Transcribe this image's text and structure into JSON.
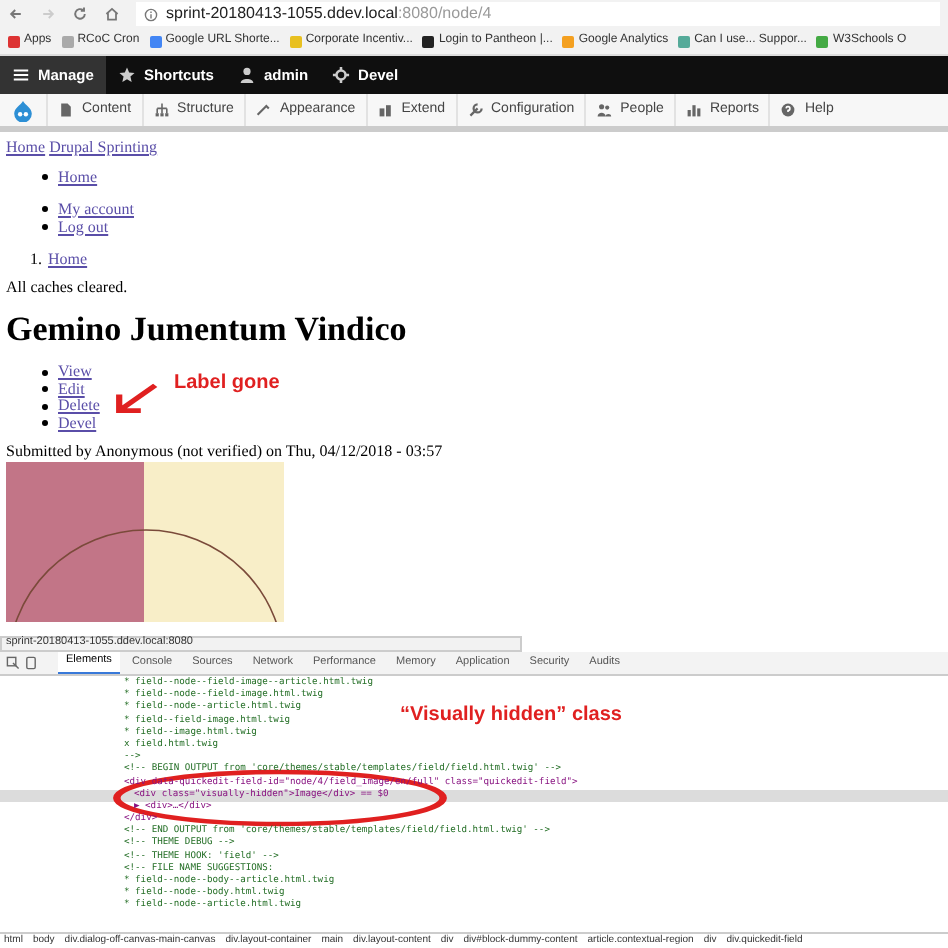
{
  "browser": {
    "url_host": "sprint-20180413-1055.ddev.local",
    "url_rest": ":8080/node/4",
    "bookmarks": [
      "Apps",
      "RCoC Cron",
      "Google URL Shorte...",
      "Corporate Incentiv...",
      "Login to Pantheon |...",
      "Google Analytics",
      "Can I use... Suppor...",
      "W3Schools O"
    ]
  },
  "toolbar": [
    {
      "label": "Manage",
      "selected": true
    },
    {
      "label": "Shortcuts",
      "selected": false
    },
    {
      "label": "admin",
      "selected": false
    },
    {
      "label": "Devel",
      "selected": false
    }
  ],
  "admin_menu": [
    "Content",
    "Structure",
    "Appearance",
    "Extend",
    "Configuration",
    "People",
    "Reports",
    "Help"
  ],
  "page": {
    "logo_alt": "Home",
    "site_name": "Drupal Sprinting",
    "main_menu": [
      "Home"
    ],
    "account_menu": [
      "My account",
      "Log out"
    ],
    "breadcrumb": [
      {
        "number": "1.",
        "label": "Home"
      }
    ],
    "message": "All caches cleared.",
    "title": "Gemino Jumentum Vindico",
    "tabs": [
      "View",
      "Edit",
      "Delete",
      "Devel"
    ],
    "submitted": "Submitted by Anonymous (not verified) on Thu, 04/12/2018 - 03:57"
  },
  "annotations": [
    "Label gone",
    "“Visually hidden” class"
  ],
  "status_url": "sprint-20180413-1055.ddev.local:8080",
  "devtools": {
    "tabs": [
      {
        "label": "Elements",
        "selected": true
      },
      {
        "label": "Console",
        "selected": false
      },
      {
        "label": "Sources",
        "selected": false
      },
      {
        "label": "Network",
        "selected": false
      },
      {
        "label": "Performance",
        "selected": false
      },
      {
        "label": "Memory",
        "selected": false
      },
      {
        "label": "Application",
        "selected": false
      },
      {
        "label": "Security",
        "selected": false
      },
      {
        "label": "Audits",
        "selected": false
      }
    ],
    "lines": [
      {
        "kind": "comment",
        "text": "* field--node--field-image--article.html.twig",
        "selected": false
      },
      {
        "kind": "comment",
        "text": "* field--node--field-image.html.twig",
        "selected": false
      },
      {
        "kind": "comment",
        "text": "* field--node--article.html.twig",
        "selected": false
      },
      {
        "kind": "comment",
        "text": "* field--field-image.html.twig",
        "selected": false
      },
      {
        "kind": "comment",
        "text": "* field--image.html.twig",
        "selected": false
      },
      {
        "kind": "comment",
        "text": "x field.html.twig",
        "selected": false
      },
      {
        "kind": "comment",
        "text": "-->",
        "selected": false
      },
      {
        "kind": "comment",
        "text": "<!-- BEGIN OUTPUT from 'core/themes/stable/templates/field/field.html.twig' -->",
        "selected": false
      },
      {
        "kind": "element",
        "text": "<div data-quickedit-field-id=\"node/4/field_image/en/full\" class=\"quickedit-field\">",
        "selected": false,
        "children": [
          {
            "kind": "element",
            "text": "<div class=\"visually-hidden\">Image</div> == $0",
            "selected": true
          },
          {
            "kind": "element",
            "text": "▶ <div>…</div>",
            "selected": false
          }
        ]
      },
      {
        "kind": "element",
        "text": "</div>",
        "selected": false
      },
      {
        "kind": "comment",
        "text": "<!-- END OUTPUT from 'core/themes/stable/templates/field/field.html.twig' -->",
        "selected": false
      },
      {
        "kind": "comment",
        "text": "<!-- THEME DEBUG -->",
        "selected": false
      },
      {
        "kind": "comment",
        "text": "<!-- THEME HOOK: 'field' -->",
        "selected": false
      },
      {
        "kind": "comment",
        "text": "<!-- FILE NAME SUGGESTIONS:",
        "selected": false
      },
      {
        "kind": "comment",
        "text": "* field--node--body--article.html.twig",
        "selected": false
      },
      {
        "kind": "comment",
        "text": "* field--node--body.html.twig",
        "selected": false
      },
      {
        "kind": "comment",
        "text": "* field--node--article.html.twig",
        "selected": false
      }
    ],
    "breadcrumb": [
      "html",
      "body",
      "div.dialog-off-canvas-main-canvas",
      "div.layout-container",
      "main",
      "div.layout-content",
      "div",
      "div#block-dummy-content",
      "article.contextual-region",
      "div",
      "div.quickedit-field"
    ]
  }
}
